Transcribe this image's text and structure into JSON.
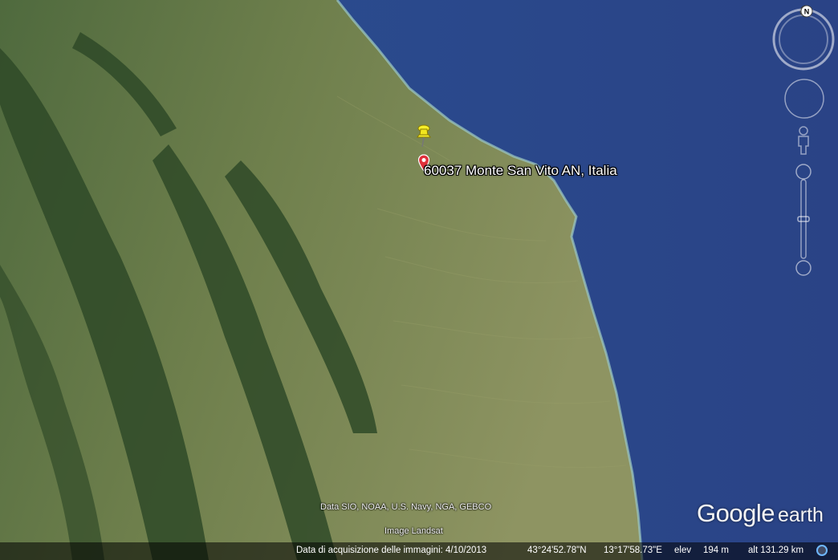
{
  "map": {
    "place_label": "60037 Monte San Vito AN, Italia",
    "colors": {
      "sea": "#2a4a8a",
      "land": "#7a8a52",
      "mountain": "#2e4a26",
      "coast": "#9dc9c8"
    }
  },
  "attribution": {
    "data": "Data SIO, NOAA, U.S. Navy, NGA, GEBCO",
    "image": "Image Landsat"
  },
  "logo": {
    "google": "Google",
    "earth": "earth"
  },
  "navigation": {
    "north_label": "N"
  },
  "status_bar": {
    "imagery_date": "Data di acquisizione delle immagini: 4/10/2013",
    "latitude": "43°24'52.78\"N",
    "longitude": "13°17'58.73\"E",
    "elev_label": "elev",
    "elev_value": "194 m",
    "alt_label": "alt 131.29 km"
  },
  "icons": [
    "placemark-pin-icon",
    "pushpin-icon",
    "compass-ring-icon",
    "look-joystick-icon",
    "street-view-pegman-icon",
    "zoom-slider-icon",
    "streaming-status-icon"
  ]
}
